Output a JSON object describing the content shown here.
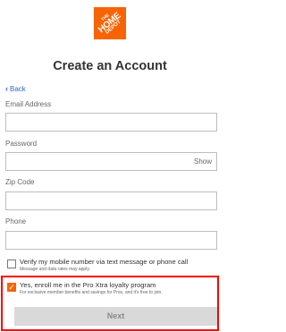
{
  "brand": {
    "logo_line1": "THE",
    "logo_line2": "HOME",
    "logo_line3": "DEPOT",
    "color": "#f96302",
    "icon": "home-depot-logo"
  },
  "page": {
    "title": "Create an Account",
    "back_label": "Back"
  },
  "form": {
    "email": {
      "label": "Email Address",
      "value": ""
    },
    "password": {
      "label": "Password",
      "value": "",
      "show_label": "Show"
    },
    "zip": {
      "label": "Zip Code",
      "value": ""
    },
    "phone": {
      "label": "Phone",
      "value": ""
    }
  },
  "verify_option": {
    "checked": false,
    "label": "Verify my mobile number via text message or phone call",
    "sublabel": "Message and data rates may apply."
  },
  "pro_xtra_option": {
    "checked": true,
    "label": "Yes, enroll me in the Pro Xtra loyalty program",
    "sublabel": "For exclusive member benefits and savings for Pros, and it's free to join."
  },
  "next_button": {
    "label": "Next",
    "enabled": false
  },
  "colors": {
    "highlight_border": "#ff0000",
    "link": "#3366cc",
    "button_disabled_bg": "#d9d9d9"
  }
}
